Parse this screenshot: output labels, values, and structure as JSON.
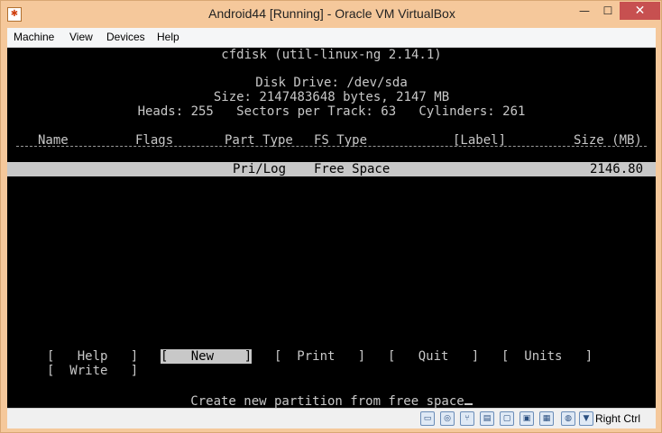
{
  "window": {
    "title": "Android44 [Running] - Oracle VM VirtualBox",
    "minimize": "—",
    "maximize": "☐",
    "close": "✕"
  },
  "menubar": [
    "Machine",
    "View",
    "Devices",
    "Help"
  ],
  "terminal": {
    "program": "cfdisk (util-linux-ng 2.14.1)",
    "disk_drive": "Disk Drive: /dev/sda",
    "size": "Size: 2147483648 bytes, 2147 MB",
    "geometry": "Heads: 255   Sectors per Track: 63   Cylinders: 261",
    "columns": {
      "name": "Name",
      "flags": "Flags",
      "part_type": "Part Type",
      "fs_type": "FS Type",
      "label": "[Label]",
      "size": "Size (MB)"
    },
    "rows": [
      {
        "part_type": "Pri/Log",
        "fs_type": "Free Space",
        "size": "2146.80"
      }
    ],
    "menu": {
      "help": "[   Help   ]",
      "new": "[   New    ]",
      "print": "[  Print   ]",
      "quit": "[   Quit   ]",
      "units": "[  Units   ]",
      "write": "[  Write   ]",
      "selected": "new"
    },
    "status": "Create new partition from free space"
  },
  "statusbar": {
    "icons": [
      "hard-disk-icon",
      "optical-drive-icon",
      "usb-icon",
      "shared-folders-icon",
      "display-icon",
      "video-capture-icon",
      "network-icon",
      "mouse-integration-icon"
    ],
    "host_key": "Right Ctrl"
  },
  "colors": {
    "frame": "#f5c89b",
    "close_button": "#c75050",
    "terminal_bg": "#000000",
    "terminal_fg": "#c8c8c8"
  }
}
